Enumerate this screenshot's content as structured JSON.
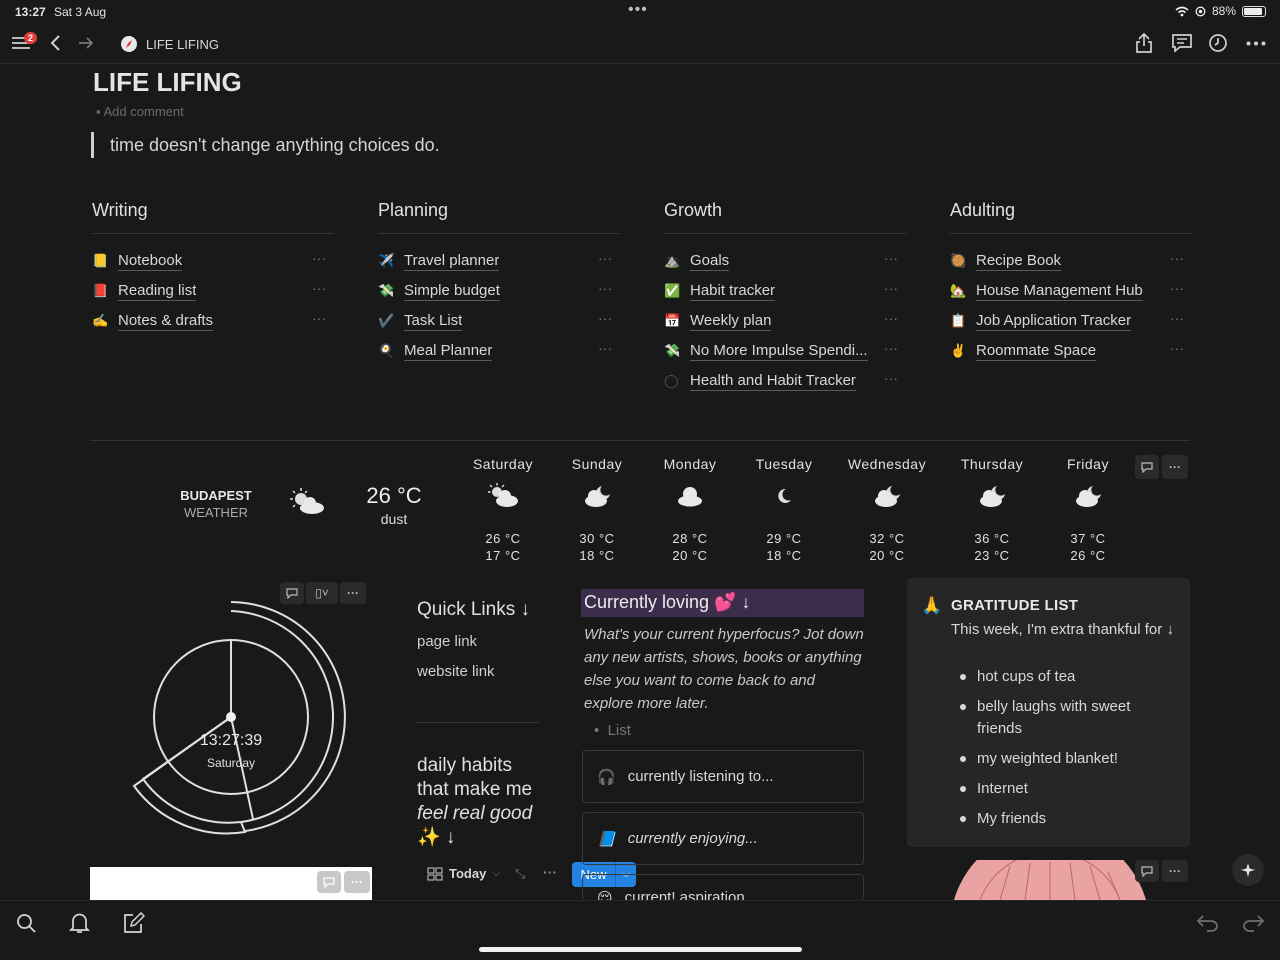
{
  "status": {
    "time": "13:27",
    "date": "Sat 3 Aug",
    "battery": "88%",
    "battery_level": 0.88
  },
  "topbar": {
    "badge": "2",
    "breadcrumb": "LIFE LIFING"
  },
  "page": {
    "title": "LIFE LIFING",
    "add_comment": "Add comment",
    "quote": "time doesn't change anything choices do."
  },
  "columns": [
    {
      "title": "Writing",
      "items": [
        {
          "icon": "notebook-icon",
          "emoji": "📒",
          "label": "Notebook"
        },
        {
          "icon": "book-icon",
          "emoji": "📕",
          "label": "Reading list"
        },
        {
          "icon": "writing-hand-icon",
          "emoji": "✍️",
          "label": "Notes & drafts"
        }
      ]
    },
    {
      "title": "Planning",
      "items": [
        {
          "icon": "airplane-icon",
          "emoji": "✈️",
          "label": "Travel planner"
        },
        {
          "icon": "money-icon",
          "emoji": "💸",
          "label": "Simple budget"
        },
        {
          "icon": "checkmark-icon",
          "emoji": "✔️",
          "label": "Task List"
        },
        {
          "icon": "egg-icon",
          "emoji": "🍳",
          "label": "Meal Planner"
        }
      ]
    },
    {
      "title": "Growth",
      "items": [
        {
          "icon": "mountain-icon",
          "emoji": "⛰️",
          "label": "Goals"
        },
        {
          "icon": "check-box-icon",
          "emoji": "✅",
          "label": "Habit tracker"
        },
        {
          "icon": "calendar-icon",
          "emoji": "📅",
          "label": "Weekly plan"
        },
        {
          "icon": "money-icon",
          "emoji": "💸",
          "label": "No More Impulse Spendi..."
        },
        {
          "icon": "circle-check-icon",
          "emoji": "◯",
          "label": "Health and Habit Tracker"
        }
      ]
    },
    {
      "title": "Adulting",
      "items": [
        {
          "icon": "recipe-icon",
          "emoji": "🥘",
          "label": "Recipe Book"
        },
        {
          "icon": "house-icon",
          "emoji": "🏡",
          "label": "House Management Hub"
        },
        {
          "icon": "clipboard-icon",
          "emoji": "📋",
          "label": "Job Application Tracker"
        },
        {
          "icon": "victory-hand-icon",
          "emoji": "✌️",
          "label": "Roommate Space"
        }
      ]
    }
  ],
  "weather": {
    "city": "BUDAPEST",
    "label": "WEATHER",
    "now_temp": "26 °C",
    "now_cond": "dust",
    "days": [
      {
        "name": "Saturday",
        "icon": "partly-sunny-icon",
        "hi": "26 °C",
        "lo": "17 °C"
      },
      {
        "name": "Sunday",
        "icon": "cloud-moon-icon",
        "hi": "30 °C",
        "lo": "18 °C"
      },
      {
        "name": "Monday",
        "icon": "cloud-icon",
        "hi": "28 °C",
        "lo": "20 °C"
      },
      {
        "name": "Tuesday",
        "icon": "moon-icon",
        "hi": "29 °C",
        "lo": "18 °C"
      },
      {
        "name": "Wednesday",
        "icon": "cloud-moon-icon",
        "hi": "32 °C",
        "lo": "20 °C"
      },
      {
        "name": "Thursday",
        "icon": "cloud-moon-icon",
        "hi": "36 °C",
        "lo": "23 °C"
      },
      {
        "name": "Friday",
        "icon": "cloud-moon-icon",
        "hi": "37 °C",
        "lo": "26 °C"
      }
    ]
  },
  "clock": {
    "time": "13:27:39",
    "day": "Saturday"
  },
  "quick_links": {
    "title": "Quick Links ↓",
    "links": [
      "page link",
      "website link"
    ]
  },
  "habits": {
    "line1": "daily habits",
    "line2": "that make me",
    "line3": "feel real good",
    "line4": "✨ ↓",
    "view": "Today",
    "new_label": "New"
  },
  "loving": {
    "title": "Currently loving 💕 ↓",
    "prompt": "What's your current hyperfocus? Jot down any new artists, shows, books or anything else you want to come back to and explore more later.",
    "list_placeholder": "List",
    "cards": [
      {
        "icon": "headphones-icon",
        "emoji": "🎧",
        "label": "currently listening to...",
        "italic": false
      },
      {
        "icon": "book-icon",
        "emoji": "📘",
        "label": "currently enjoying...",
        "italic": true
      },
      {
        "icon": "smile-icon",
        "emoji": "😌",
        "label": "current! aspiration"
      }
    ]
  },
  "gratitude": {
    "emoji": "🙏",
    "title": "GRATITUDE LIST",
    "subtitle": "This week, I'm extra thankful for ↓",
    "items": [
      "hot cups of tea",
      "belly laughs with sweet friends",
      "my weighted blanket!",
      "Internet",
      "My friends"
    ]
  },
  "colors": {
    "background": "#191919",
    "accent": "#2383e2",
    "highlight": "#3d2d4c",
    "badge": "#e03e3e"
  }
}
